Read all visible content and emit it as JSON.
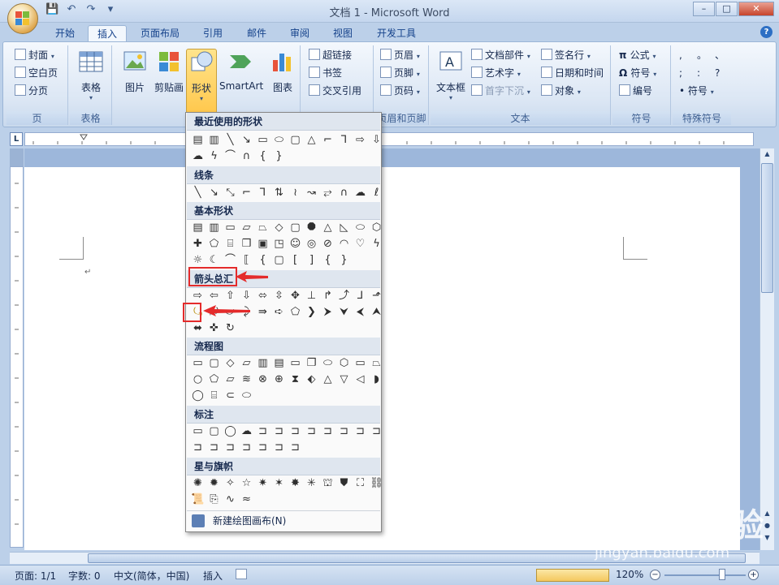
{
  "window": {
    "title": "文档 1 - Microsoft Word",
    "controls": [
      "–",
      "□",
      "✕"
    ]
  },
  "tabs": [
    "开始",
    "插入",
    "页面布局",
    "引用",
    "邮件",
    "审阅",
    "视图",
    "开发工具"
  ],
  "active_tab": "插入",
  "ribbon": {
    "pages_group": {
      "label": "页",
      "items": [
        "封面",
        "空白页",
        "分页"
      ]
    },
    "table_group": {
      "label": "表格",
      "button": "表格"
    },
    "illustrations": {
      "picture": "图片",
      "clipart": "剪贴画",
      "shapes": "形状",
      "smartart": "SmartArt",
      "chart": "图表"
    },
    "links": {
      "hyperlink": "超链接",
      "bookmark": "书签",
      "crossref": "交叉引用"
    },
    "header_footer": {
      "label": "页眉和页脚",
      "header": "页眉",
      "footer": "页脚",
      "page_number": "页码"
    },
    "text_group": {
      "label": "文本",
      "textbox": "文本框",
      "quickparts": "文档部件",
      "wordart": "艺术字",
      "dropcap": "首字下沉",
      "signature": "签名行",
      "datetime": "日期和时间",
      "object": "对象"
    },
    "symbols": {
      "label": "符号",
      "equation": "公式",
      "symbol": "符号",
      "numbering": "编号"
    },
    "special": {
      "label": "特殊符号",
      "chars": [
        ",",
        "。",
        "、",
        ";",
        ":",
        "?"
      ],
      "symbol": "符号"
    }
  },
  "shapes_menu": {
    "recent": "最近使用的形状",
    "lines": "线条",
    "basic": "基本形状",
    "arrows": "箭头总汇",
    "flowchart": "流程图",
    "callouts": "标注",
    "stars": "星与旗帜",
    "new_canvas": "新建绘图画布(N)"
  },
  "statusbar": {
    "page": "页面: 1/1",
    "words": "字数: 0",
    "language": "中文(简体，中国)",
    "mode": "插入",
    "zoom": "120%"
  },
  "watermark": {
    "text": "Baidu经验",
    "url": "jingyan.baidu.com"
  }
}
